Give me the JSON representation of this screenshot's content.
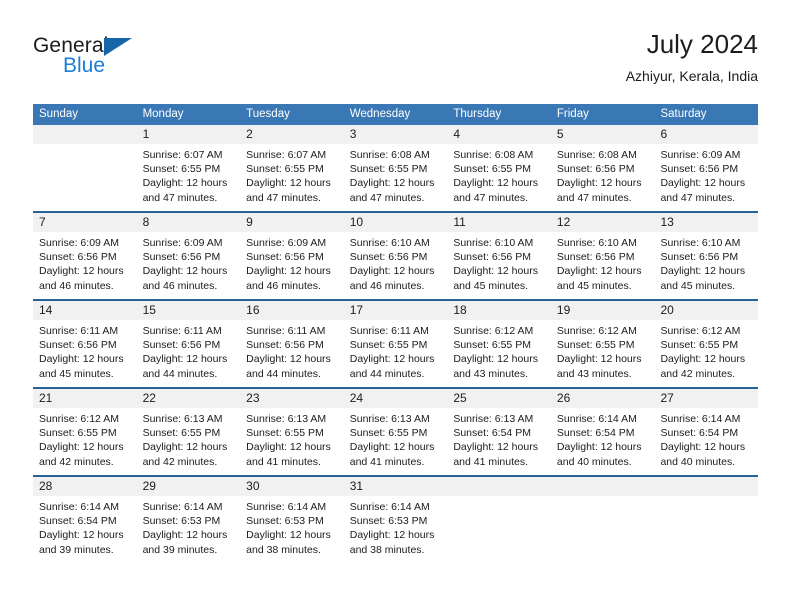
{
  "brand": {
    "name_top": "General",
    "name_bottom": "Blue",
    "accent_color": "#1b7fd4",
    "triangle_color": "#1565a8"
  },
  "header": {
    "title": "July 2024",
    "subtitle": "Azhiyur, Kerala, India"
  },
  "theme": {
    "header_bg": "#3a78b5",
    "header_text": "#ffffff",
    "date_band_bg": "#f1f1f1",
    "week_rule": "#2a6099"
  },
  "calendar": {
    "weekdays": [
      "Sunday",
      "Monday",
      "Tuesday",
      "Wednesday",
      "Thursday",
      "Friday",
      "Saturday"
    ],
    "weeks": [
      [
        {
          "date": "",
          "sunrise": "",
          "sunset": "",
          "daylight_1": "",
          "daylight_2": "",
          "empty": true
        },
        {
          "date": "1",
          "sunrise": "Sunrise: 6:07 AM",
          "sunset": "Sunset: 6:55 PM",
          "daylight_1": "Daylight: 12 hours",
          "daylight_2": "and 47 minutes."
        },
        {
          "date": "2",
          "sunrise": "Sunrise: 6:07 AM",
          "sunset": "Sunset: 6:55 PM",
          "daylight_1": "Daylight: 12 hours",
          "daylight_2": "and 47 minutes."
        },
        {
          "date": "3",
          "sunrise": "Sunrise: 6:08 AM",
          "sunset": "Sunset: 6:55 PM",
          "daylight_1": "Daylight: 12 hours",
          "daylight_2": "and 47 minutes."
        },
        {
          "date": "4",
          "sunrise": "Sunrise: 6:08 AM",
          "sunset": "Sunset: 6:55 PM",
          "daylight_1": "Daylight: 12 hours",
          "daylight_2": "and 47 minutes."
        },
        {
          "date": "5",
          "sunrise": "Sunrise: 6:08 AM",
          "sunset": "Sunset: 6:56 PM",
          "daylight_1": "Daylight: 12 hours",
          "daylight_2": "and 47 minutes."
        },
        {
          "date": "6",
          "sunrise": "Sunrise: 6:09 AM",
          "sunset": "Sunset: 6:56 PM",
          "daylight_1": "Daylight: 12 hours",
          "daylight_2": "and 47 minutes."
        }
      ],
      [
        {
          "date": "7",
          "sunrise": "Sunrise: 6:09 AM",
          "sunset": "Sunset: 6:56 PM",
          "daylight_1": "Daylight: 12 hours",
          "daylight_2": "and 46 minutes."
        },
        {
          "date": "8",
          "sunrise": "Sunrise: 6:09 AM",
          "sunset": "Sunset: 6:56 PM",
          "daylight_1": "Daylight: 12 hours",
          "daylight_2": "and 46 minutes."
        },
        {
          "date": "9",
          "sunrise": "Sunrise: 6:09 AM",
          "sunset": "Sunset: 6:56 PM",
          "daylight_1": "Daylight: 12 hours",
          "daylight_2": "and 46 minutes."
        },
        {
          "date": "10",
          "sunrise": "Sunrise: 6:10 AM",
          "sunset": "Sunset: 6:56 PM",
          "daylight_1": "Daylight: 12 hours",
          "daylight_2": "and 46 minutes."
        },
        {
          "date": "11",
          "sunrise": "Sunrise: 6:10 AM",
          "sunset": "Sunset: 6:56 PM",
          "daylight_1": "Daylight: 12 hours",
          "daylight_2": "and 45 minutes."
        },
        {
          "date": "12",
          "sunrise": "Sunrise: 6:10 AM",
          "sunset": "Sunset: 6:56 PM",
          "daylight_1": "Daylight: 12 hours",
          "daylight_2": "and 45 minutes."
        },
        {
          "date": "13",
          "sunrise": "Sunrise: 6:10 AM",
          "sunset": "Sunset: 6:56 PM",
          "daylight_1": "Daylight: 12 hours",
          "daylight_2": "and 45 minutes."
        }
      ],
      [
        {
          "date": "14",
          "sunrise": "Sunrise: 6:11 AM",
          "sunset": "Sunset: 6:56 PM",
          "daylight_1": "Daylight: 12 hours",
          "daylight_2": "and 45 minutes."
        },
        {
          "date": "15",
          "sunrise": "Sunrise: 6:11 AM",
          "sunset": "Sunset: 6:56 PM",
          "daylight_1": "Daylight: 12 hours",
          "daylight_2": "and 44 minutes."
        },
        {
          "date": "16",
          "sunrise": "Sunrise: 6:11 AM",
          "sunset": "Sunset: 6:56 PM",
          "daylight_1": "Daylight: 12 hours",
          "daylight_2": "and 44 minutes."
        },
        {
          "date": "17",
          "sunrise": "Sunrise: 6:11 AM",
          "sunset": "Sunset: 6:55 PM",
          "daylight_1": "Daylight: 12 hours",
          "daylight_2": "and 44 minutes."
        },
        {
          "date": "18",
          "sunrise": "Sunrise: 6:12 AM",
          "sunset": "Sunset: 6:55 PM",
          "daylight_1": "Daylight: 12 hours",
          "daylight_2": "and 43 minutes."
        },
        {
          "date": "19",
          "sunrise": "Sunrise: 6:12 AM",
          "sunset": "Sunset: 6:55 PM",
          "daylight_1": "Daylight: 12 hours",
          "daylight_2": "and 43 minutes."
        },
        {
          "date": "20",
          "sunrise": "Sunrise: 6:12 AM",
          "sunset": "Sunset: 6:55 PM",
          "daylight_1": "Daylight: 12 hours",
          "daylight_2": "and 42 minutes."
        }
      ],
      [
        {
          "date": "21",
          "sunrise": "Sunrise: 6:12 AM",
          "sunset": "Sunset: 6:55 PM",
          "daylight_1": "Daylight: 12 hours",
          "daylight_2": "and 42 minutes."
        },
        {
          "date": "22",
          "sunrise": "Sunrise: 6:13 AM",
          "sunset": "Sunset: 6:55 PM",
          "daylight_1": "Daylight: 12 hours",
          "daylight_2": "and 42 minutes."
        },
        {
          "date": "23",
          "sunrise": "Sunrise: 6:13 AM",
          "sunset": "Sunset: 6:55 PM",
          "daylight_1": "Daylight: 12 hours",
          "daylight_2": "and 41 minutes."
        },
        {
          "date": "24",
          "sunrise": "Sunrise: 6:13 AM",
          "sunset": "Sunset: 6:55 PM",
          "daylight_1": "Daylight: 12 hours",
          "daylight_2": "and 41 minutes."
        },
        {
          "date": "25",
          "sunrise": "Sunrise: 6:13 AM",
          "sunset": "Sunset: 6:54 PM",
          "daylight_1": "Daylight: 12 hours",
          "daylight_2": "and 41 minutes."
        },
        {
          "date": "26",
          "sunrise": "Sunrise: 6:14 AM",
          "sunset": "Sunset: 6:54 PM",
          "daylight_1": "Daylight: 12 hours",
          "daylight_2": "and 40 minutes."
        },
        {
          "date": "27",
          "sunrise": "Sunrise: 6:14 AM",
          "sunset": "Sunset: 6:54 PM",
          "daylight_1": "Daylight: 12 hours",
          "daylight_2": "and 40 minutes."
        }
      ],
      [
        {
          "date": "28",
          "sunrise": "Sunrise: 6:14 AM",
          "sunset": "Sunset: 6:54 PM",
          "daylight_1": "Daylight: 12 hours",
          "daylight_2": "and 39 minutes."
        },
        {
          "date": "29",
          "sunrise": "Sunrise: 6:14 AM",
          "sunset": "Sunset: 6:53 PM",
          "daylight_1": "Daylight: 12 hours",
          "daylight_2": "and 39 minutes."
        },
        {
          "date": "30",
          "sunrise": "Sunrise: 6:14 AM",
          "sunset": "Sunset: 6:53 PM",
          "daylight_1": "Daylight: 12 hours",
          "daylight_2": "and 38 minutes."
        },
        {
          "date": "31",
          "sunrise": "Sunrise: 6:14 AM",
          "sunset": "Sunset: 6:53 PM",
          "daylight_1": "Daylight: 12 hours",
          "daylight_2": "and 38 minutes."
        },
        {
          "date": "",
          "sunrise": "",
          "sunset": "",
          "daylight_1": "",
          "daylight_2": "",
          "empty": true
        },
        {
          "date": "",
          "sunrise": "",
          "sunset": "",
          "daylight_1": "",
          "daylight_2": "",
          "empty": true
        },
        {
          "date": "",
          "sunrise": "",
          "sunset": "",
          "daylight_1": "",
          "daylight_2": "",
          "empty": true
        }
      ]
    ]
  }
}
